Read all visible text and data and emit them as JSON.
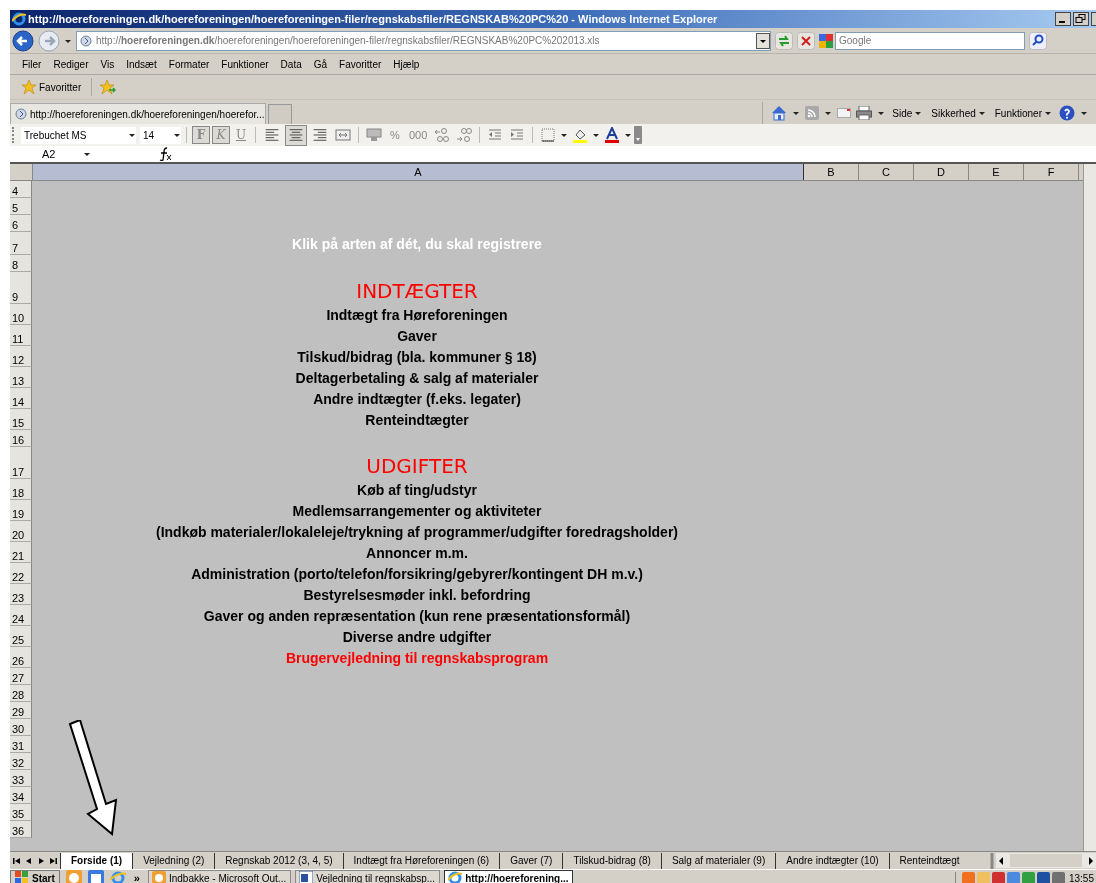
{
  "window": {
    "title": "http://hoereforeningen.dk/hoereforeningen/hoereforeningen-filer/regnskabsfiler/REGNSKAB%20PC%20 - Windows Internet Explorer"
  },
  "address_bar": {
    "url": "http://**hoereforeningen.dk**/hoereforeningen/hoereforeningen-filer/regnskabsfiler/REGNSKAB%20PC%202013.xls",
    "search_placeholder": "Google"
  },
  "menu": {
    "items": [
      "Filer",
      "Rediger",
      "Vis",
      "Indsæt",
      "Formater",
      "Funktioner",
      "Data",
      "Gå",
      "Favoritter",
      "Hjælp"
    ]
  },
  "favorites_bar": {
    "label": "Favoritter"
  },
  "browser_tab": {
    "title": "http://hoereforeningen.dk/hoereforeningen/hoerefor..."
  },
  "command_bar": {
    "items": [
      "Side",
      "Sikkerhed",
      "Funktioner"
    ]
  },
  "format_toolbar": {
    "font": "Trebuchet MS",
    "size": "14",
    "style_buttons": [
      {
        "label": "F",
        "pressed": true
      },
      {
        "label": "K",
        "pressed": true
      },
      {
        "label": "U",
        "pressed": false
      }
    ],
    "align_buttons": [
      {
        "kind": "left",
        "pressed": false
      },
      {
        "kind": "center",
        "pressed": true
      },
      {
        "kind": "right",
        "pressed": false
      }
    ],
    "percent": "%",
    "thousands": "000"
  },
  "formula_bar": {
    "cell": "A2"
  },
  "sheet": {
    "columns": [
      {
        "label": "A",
        "selected": true
      },
      {
        "label": "B",
        "selected": false
      },
      {
        "label": "C",
        "selected": false
      },
      {
        "label": "D",
        "selected": false
      },
      {
        "label": "E",
        "selected": false
      },
      {
        "label": "F",
        "selected": false
      }
    ],
    "rows": [
      {
        "number": "4",
        "kind": "blank"
      },
      {
        "number": "5",
        "kind": "blank"
      },
      {
        "number": "6",
        "kind": "blank"
      },
      {
        "number": "7",
        "kind": "intro",
        "text": "Klik på arten af dét, du skal registrere"
      },
      {
        "number": "8",
        "kind": "blank"
      },
      {
        "number": "9",
        "kind": "heading",
        "text": "INDTÆGTER"
      },
      {
        "number": "10",
        "kind": "item",
        "text": "Indtægt fra Høreforeningen"
      },
      {
        "number": "11",
        "kind": "item",
        "text": "Gaver"
      },
      {
        "number": "12",
        "kind": "item",
        "text": "Tilskud/bidrag (bla. kommuner § 18)"
      },
      {
        "number": "13",
        "kind": "item",
        "text": "Deltagerbetaling & salg af materialer"
      },
      {
        "number": "14",
        "kind": "item",
        "text": "Andre indtægter (f.eks. legater)"
      },
      {
        "number": "15",
        "kind": "item",
        "text": "Renteindtægter"
      },
      {
        "number": "16",
        "kind": "blank"
      },
      {
        "number": "17",
        "kind": "heading",
        "text": "UDGIFTER"
      },
      {
        "number": "18",
        "kind": "item",
        "text": "Køb af ting/udstyr"
      },
      {
        "number": "19",
        "kind": "item",
        "text": "Medlemsarrangementer og aktiviteter"
      },
      {
        "number": "20",
        "kind": "item",
        "text": "(Indkøb materialer/lokaleleje/trykning af programmer/udgifter foredragsholder)"
      },
      {
        "number": "21",
        "kind": "item",
        "text": "Annoncer m.m."
      },
      {
        "number": "22",
        "kind": "item",
        "text": "Administration (porto/telefon/forsikring/gebyrer/kontingent DH m.v.)"
      },
      {
        "number": "23",
        "kind": "item",
        "text": "Bestyrelsesmøder inkl. befordring"
      },
      {
        "number": "24",
        "kind": "item",
        "text": "Gaver og anden repræsentation (kun rene præsentationsformål)"
      },
      {
        "number": "25",
        "kind": "item",
        "text": "Diverse andre udgifter"
      },
      {
        "number": "26",
        "kind": "link",
        "text": "Brugervejledning til regnskabsprogram"
      },
      {
        "number": "27",
        "kind": "blank"
      },
      {
        "number": "28",
        "kind": "blank"
      },
      {
        "number": "29",
        "kind": "blank"
      },
      {
        "number": "30",
        "kind": "blank"
      },
      {
        "number": "31",
        "kind": "blank"
      },
      {
        "number": "32",
        "kind": "blank"
      },
      {
        "number": "33",
        "kind": "blank"
      },
      {
        "number": "34",
        "kind": "blank"
      },
      {
        "number": "35",
        "kind": "blank"
      },
      {
        "number": "36",
        "kind": "blank"
      }
    ]
  },
  "sheet_tabs": [
    {
      "label": "Forside (1)",
      "selected": true
    },
    {
      "label": "Vejledning (2)",
      "selected": false
    },
    {
      "label": "Regnskab 2012 (3, 4, 5)",
      "selected": false
    },
    {
      "label": "Indtægt fra Høreforeningen (6)",
      "selected": false
    },
    {
      "label": "Gaver (7)",
      "selected": false
    },
    {
      "label": "Tilskud-bidrag (8)",
      "selected": false
    },
    {
      "label": "Salg af materialer (9)",
      "selected": false
    },
    {
      "label": "Andre indtægter (10)",
      "selected": false
    },
    {
      "label": "Renteindtægt",
      "selected": false
    }
  ],
  "taskbar": {
    "start": "Start",
    "more": "»",
    "tasks": [
      {
        "label": "Indbakke - Microsoft Out...",
        "selected": false
      },
      {
        "label": "Vejledning til regnskabsp...",
        "selected": false
      },
      {
        "label": "http://hoereforening...",
        "selected": true
      }
    ],
    "clock": "13:55"
  }
}
